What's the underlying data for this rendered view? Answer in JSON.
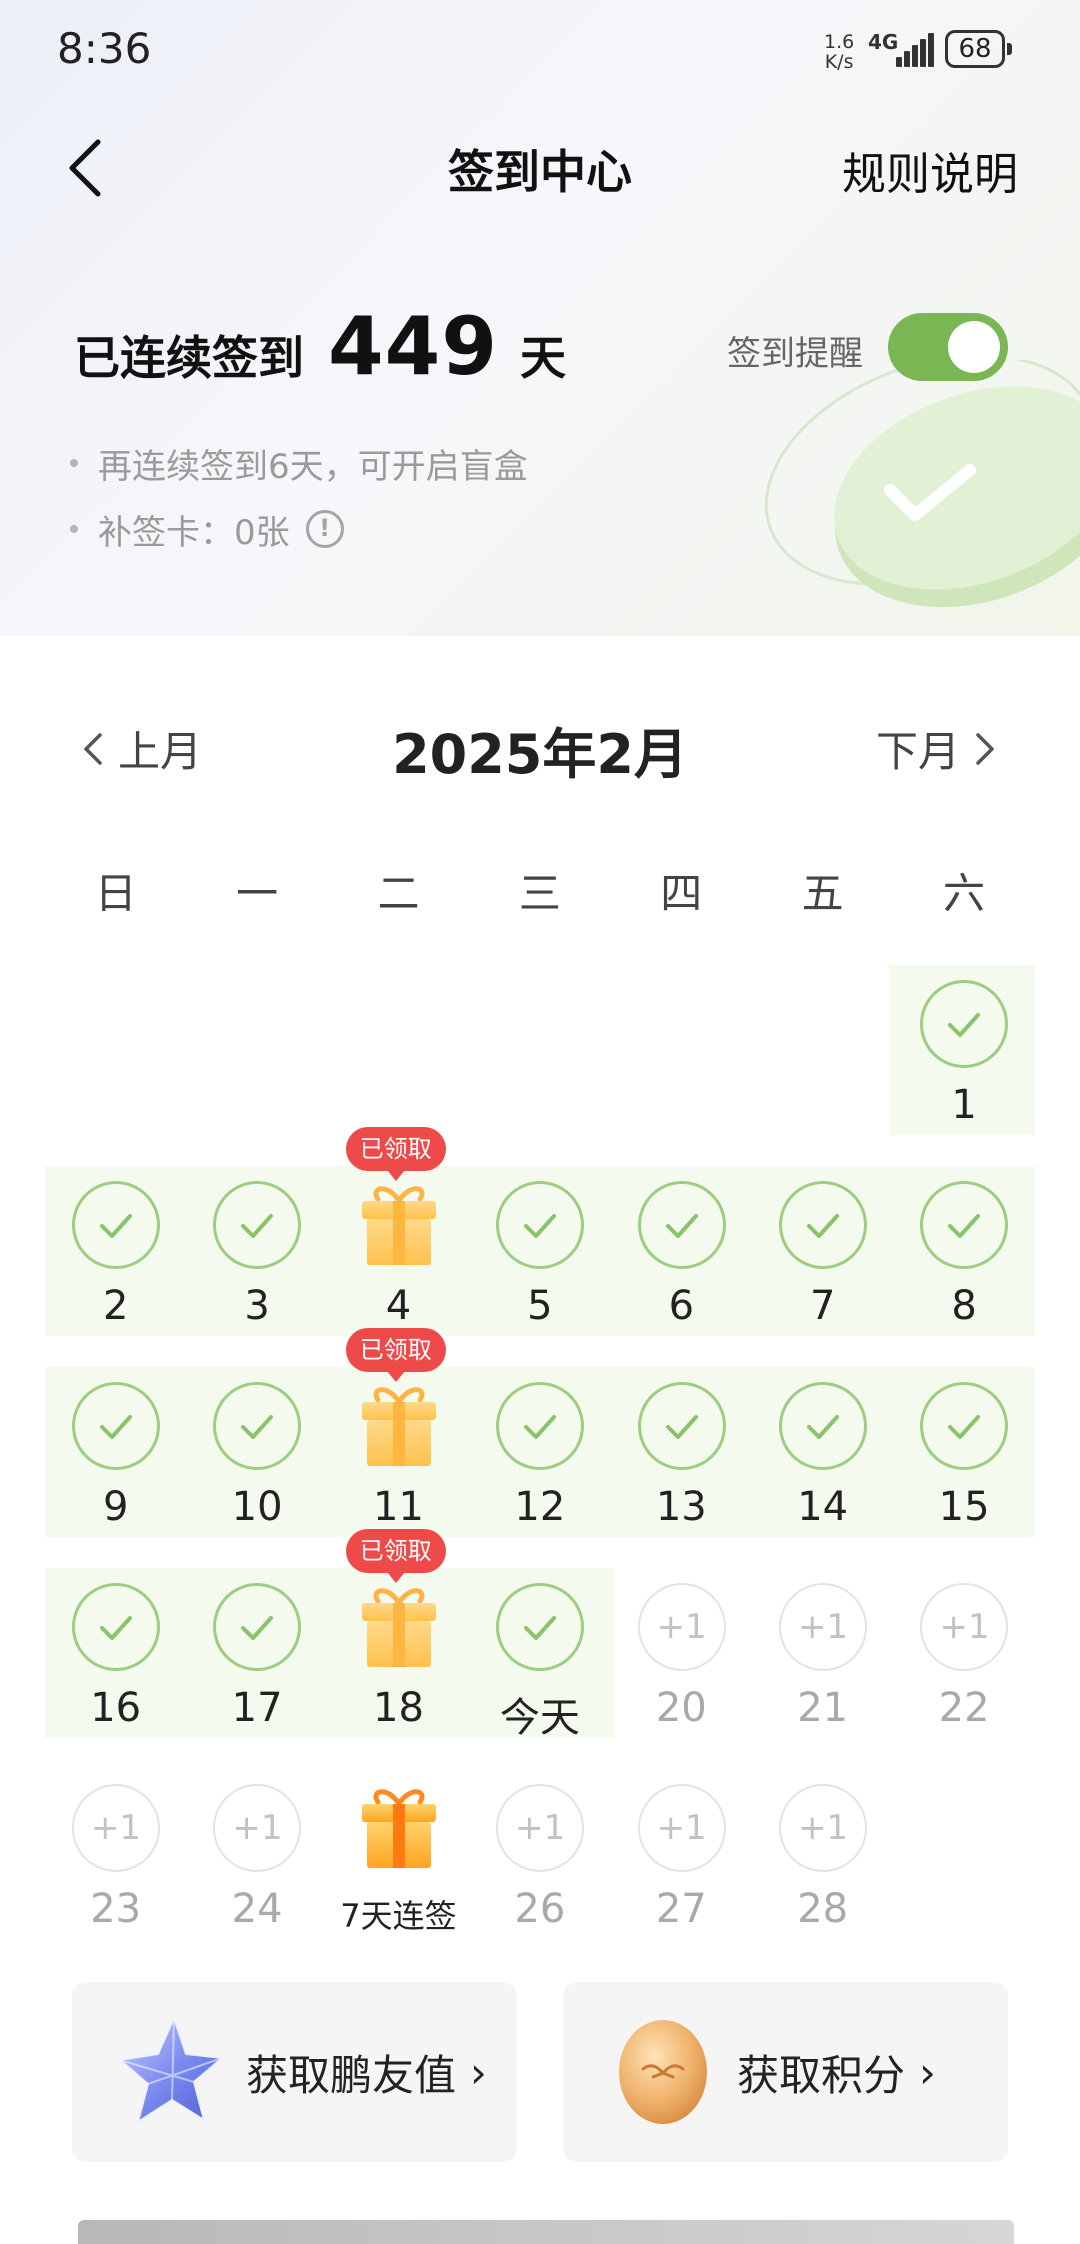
{
  "status_bar": {
    "time": "8:36",
    "net_speed": "1.6",
    "net_unit": "K/s",
    "network": "4G",
    "battery": "68"
  },
  "header": {
    "title": "签到中心",
    "rules": "规则说明"
  },
  "streak": {
    "label": "已连续签到",
    "count": "449",
    "unit": "天"
  },
  "reminder": {
    "label": "签到提醒",
    "enabled": true
  },
  "tips": [
    "再连续签到6天，可开启盲盒",
    "补签卡：0张"
  ],
  "calendar": {
    "prev": "上月",
    "next": "下月",
    "month": "2025年2月",
    "weekdays": [
      "日",
      "一",
      "二",
      "三",
      "四",
      "五",
      "六"
    ],
    "claimed_badge": "已领取",
    "future_points": "+1",
    "days": [
      {
        "label": "1",
        "status": "done"
      },
      {
        "label": "2",
        "status": "done"
      },
      {
        "label": "3",
        "status": "done"
      },
      {
        "label": "4",
        "status": "gift-claimed"
      },
      {
        "label": "5",
        "status": "done"
      },
      {
        "label": "6",
        "status": "done"
      },
      {
        "label": "7",
        "status": "done"
      },
      {
        "label": "8",
        "status": "done"
      },
      {
        "label": "9",
        "status": "done"
      },
      {
        "label": "10",
        "status": "done"
      },
      {
        "label": "11",
        "status": "gift-claimed"
      },
      {
        "label": "12",
        "status": "done"
      },
      {
        "label": "13",
        "status": "done"
      },
      {
        "label": "14",
        "status": "done"
      },
      {
        "label": "15",
        "status": "done"
      },
      {
        "label": "16",
        "status": "done"
      },
      {
        "label": "17",
        "status": "done"
      },
      {
        "label": "18",
        "status": "gift-claimed"
      },
      {
        "label": "今天",
        "status": "done"
      },
      {
        "label": "20",
        "status": "future"
      },
      {
        "label": "21",
        "status": "future"
      },
      {
        "label": "22",
        "status": "future"
      },
      {
        "label": "23",
        "status": "future"
      },
      {
        "label": "24",
        "status": "future"
      },
      {
        "label": "7天连签",
        "status": "gift-future"
      },
      {
        "label": "26",
        "status": "future"
      },
      {
        "label": "27",
        "status": "future"
      },
      {
        "label": "28",
        "status": "future"
      }
    ]
  },
  "cards": [
    {
      "label": "获取鹏友值",
      "icon": "crystal-star-icon"
    },
    {
      "label": "获取积分",
      "icon": "gold-coin-icon"
    }
  ],
  "colors": {
    "accent_green": "#7bb654",
    "check_green": "#9ccd80",
    "band": "#f4faee",
    "badge_red": "#ee4a4a"
  }
}
